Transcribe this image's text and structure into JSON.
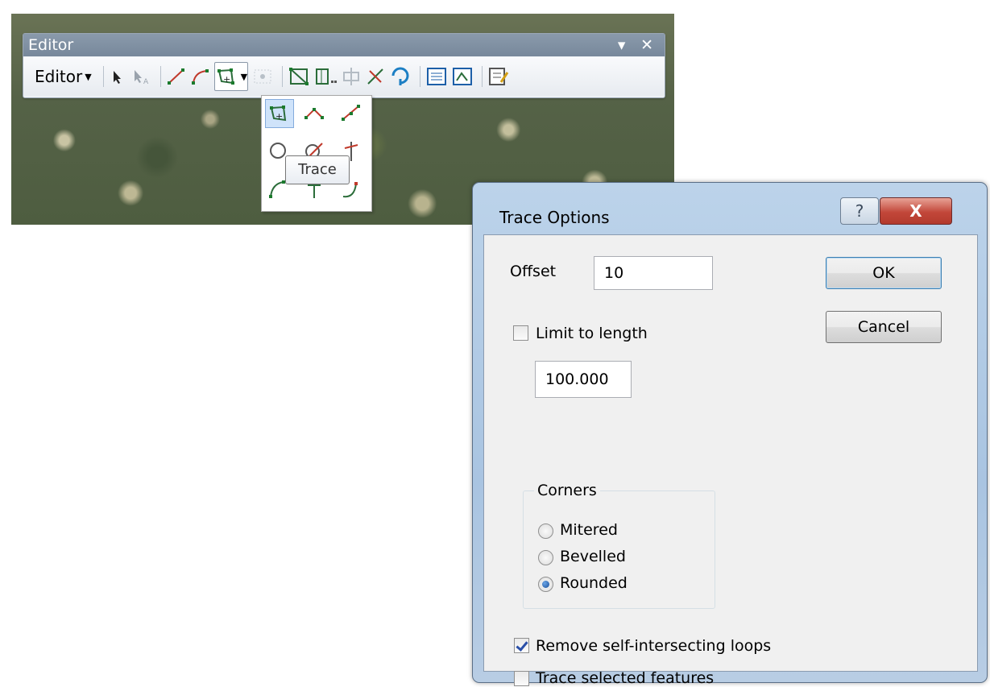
{
  "toolbar": {
    "window_title": "Editor",
    "window_buttons": "▾ ✕",
    "editor_menu_label": "Editor",
    "tools": [
      "edit-tool",
      "edit-annotation-tool",
      "straight-segment-tool",
      "end-point-arc-tool",
      "trace-tool",
      "midpoint-tool",
      "edit-vertices-tool",
      "reshape-feature-tool",
      "cut-polygons-tool",
      "split-tool",
      "rotate-tool",
      "attributes-tool",
      "sketch-properties-tool",
      "create-features-tool"
    ]
  },
  "tool_palette": {
    "tooltip": "Trace",
    "selected_tool": "trace"
  },
  "dialog": {
    "title": "Trace Options",
    "help_symbol": "?",
    "close_symbol": "X",
    "offset_label": "Offset",
    "offset_value": "10",
    "limit_label": "Limit to length",
    "limit_checked": false,
    "limit_value": "100.000",
    "corners_group_label": "Corners",
    "corner_options": [
      "Mitered",
      "Bevelled",
      "Rounded"
    ],
    "corner_selected": "Rounded",
    "remove_loops_label": "Remove self-intersecting loops",
    "remove_loops_checked": true,
    "trace_selected_label": "Trace selected features",
    "trace_selected_checked": false,
    "ok_label": "OK",
    "cancel_label": "Cancel"
  }
}
